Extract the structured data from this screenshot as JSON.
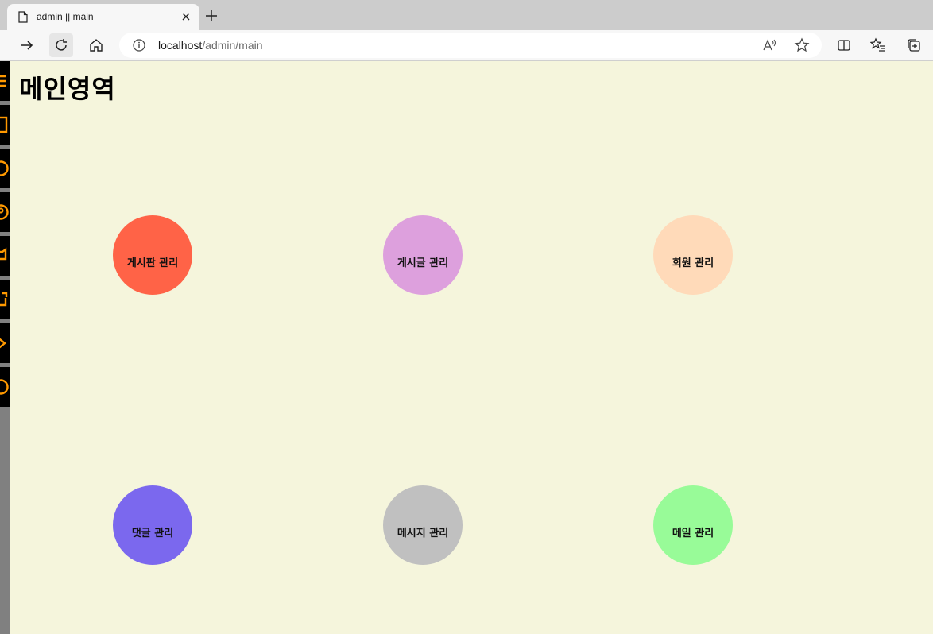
{
  "browser": {
    "tab_title": "admin || main",
    "url_host": "localhost",
    "url_path": "/admin/main"
  },
  "page": {
    "title": "메인영역",
    "background": "#f5f5dc"
  },
  "sidebar": {
    "items": [
      {
        "icon": "menu-icon"
      },
      {
        "icon": "board-icon"
      },
      {
        "icon": "post-icon"
      },
      {
        "icon": "member-icon"
      },
      {
        "icon": "comment-icon"
      },
      {
        "icon": "message-icon"
      },
      {
        "icon": "mail-icon"
      },
      {
        "icon": "logout-icon"
      }
    ],
    "icon_color": "#ff9900"
  },
  "menu_circles": [
    {
      "label": "게시판 관리",
      "color": "#ff6347"
    },
    {
      "label": "게시글 관리",
      "color": "#dda0dd"
    },
    {
      "label": "회원 관리",
      "color": "#ffdab9"
    },
    {
      "label": "댓글 관리",
      "color": "#7b68ee"
    },
    {
      "label": "메시지 관리",
      "color": "#c0c0c0"
    },
    {
      "label": "메일 관리",
      "color": "#98fb98"
    }
  ]
}
